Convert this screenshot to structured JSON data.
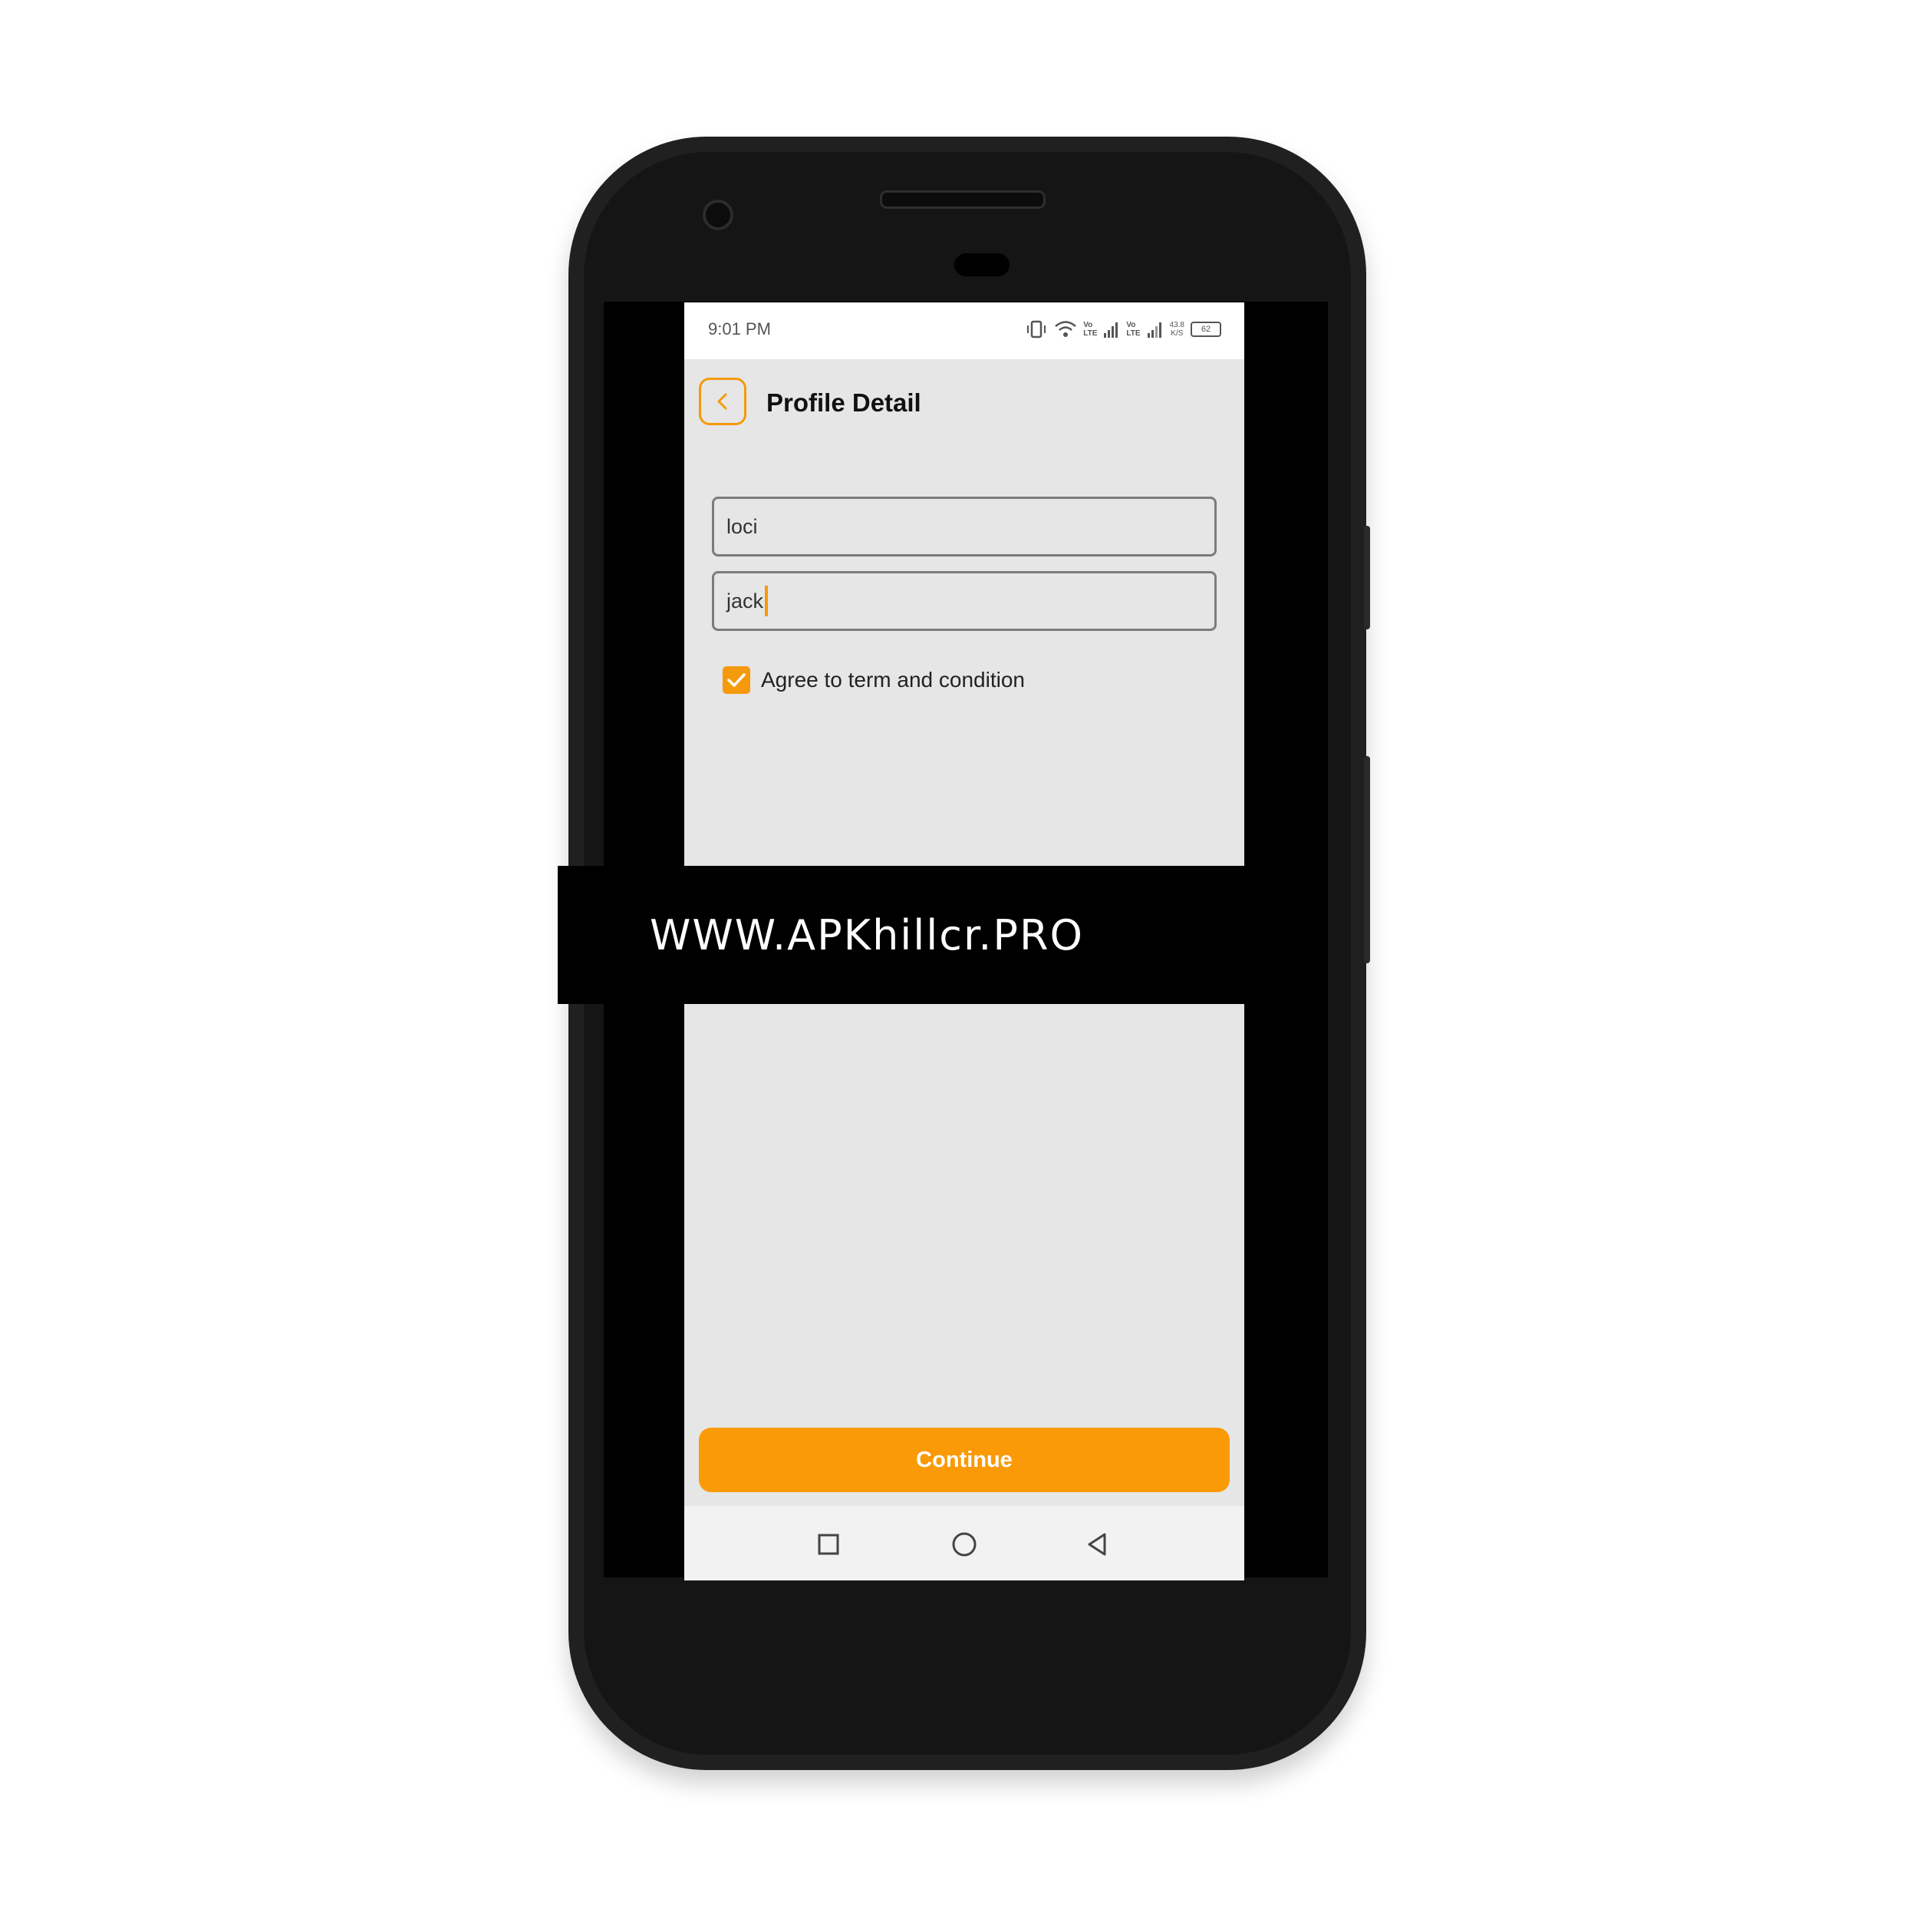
{
  "status_bar": {
    "time": "9:01 PM",
    "network_speed": "43.8",
    "network_speed_unit": "K/S",
    "battery": "62",
    "volte_labels": [
      "Vo",
      "LTE"
    ]
  },
  "header": {
    "title": "Profile Detail",
    "back_icon": "chevron-left-icon"
  },
  "form": {
    "first_name_value": "loci",
    "last_name_value": "jack",
    "agree_checked": true,
    "agree_label": "Agree to term and condition"
  },
  "continue_label": "Continue",
  "nav_bar": {
    "icons": [
      "square-recents-icon",
      "circle-home-icon",
      "triangle-back-icon"
    ]
  },
  "watermark": "WWW.APKhillcr.PRO",
  "colors": {
    "accent": "#f59a0c",
    "screen_background": "#e6e6e6"
  }
}
